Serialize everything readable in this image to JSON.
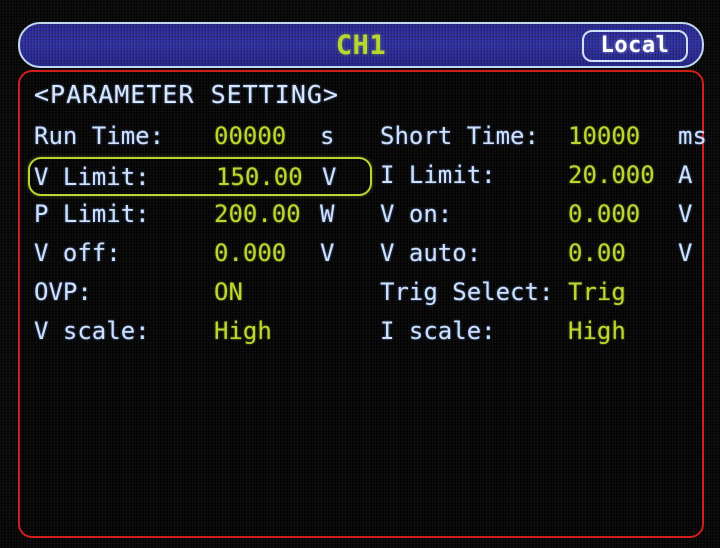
{
  "header": {
    "channel_title": "CH1",
    "local_badge": "Local",
    "bar_color": "#2b2b9e",
    "bar_border_color": "#cfe2f4",
    "title_color": "#b6d62c"
  },
  "panel": {
    "title": "<PARAMETER SETTING>",
    "border_color": "#cf1a18",
    "label_color": "#cfe0fb",
    "value_color": "#bcd62e",
    "highlight_color": "#b9d431"
  },
  "left_column": [
    {
      "label": "Run Time:",
      "value": "00000",
      "unit": "s",
      "selected": false
    },
    {
      "label": "V Limit:",
      "value": "150.00",
      "unit": "V",
      "selected": true
    },
    {
      "label": "P Limit:",
      "value": "200.00",
      "unit": "W",
      "selected": false
    },
    {
      "label": "V off:",
      "value": "0.000",
      "unit": "V",
      "selected": false
    },
    {
      "label": "OVP:",
      "value": "ON",
      "unit": "",
      "selected": false
    },
    {
      "label": "V scale:",
      "value": "High",
      "unit": "",
      "selected": false
    }
  ],
  "right_column": [
    {
      "label": "Short Time:",
      "value": "10000",
      "unit": "ms",
      "selected": false,
      "wide_label": false
    },
    {
      "label": "I Limit:",
      "value": "20.000",
      "unit": "A",
      "selected": false,
      "wide_label": false
    },
    {
      "label": "V on:",
      "value": "0.000",
      "unit": "V",
      "selected": false,
      "wide_label": false
    },
    {
      "label": "V auto:",
      "value": "0.00",
      "unit": "V",
      "selected": false,
      "wide_label": false
    },
    {
      "label": "Trig Select:",
      "value": "Trig",
      "unit": "",
      "selected": false,
      "wide_label": true
    },
    {
      "label": "I scale:",
      "value": "High",
      "unit": "",
      "selected": false,
      "wide_label": false
    }
  ]
}
